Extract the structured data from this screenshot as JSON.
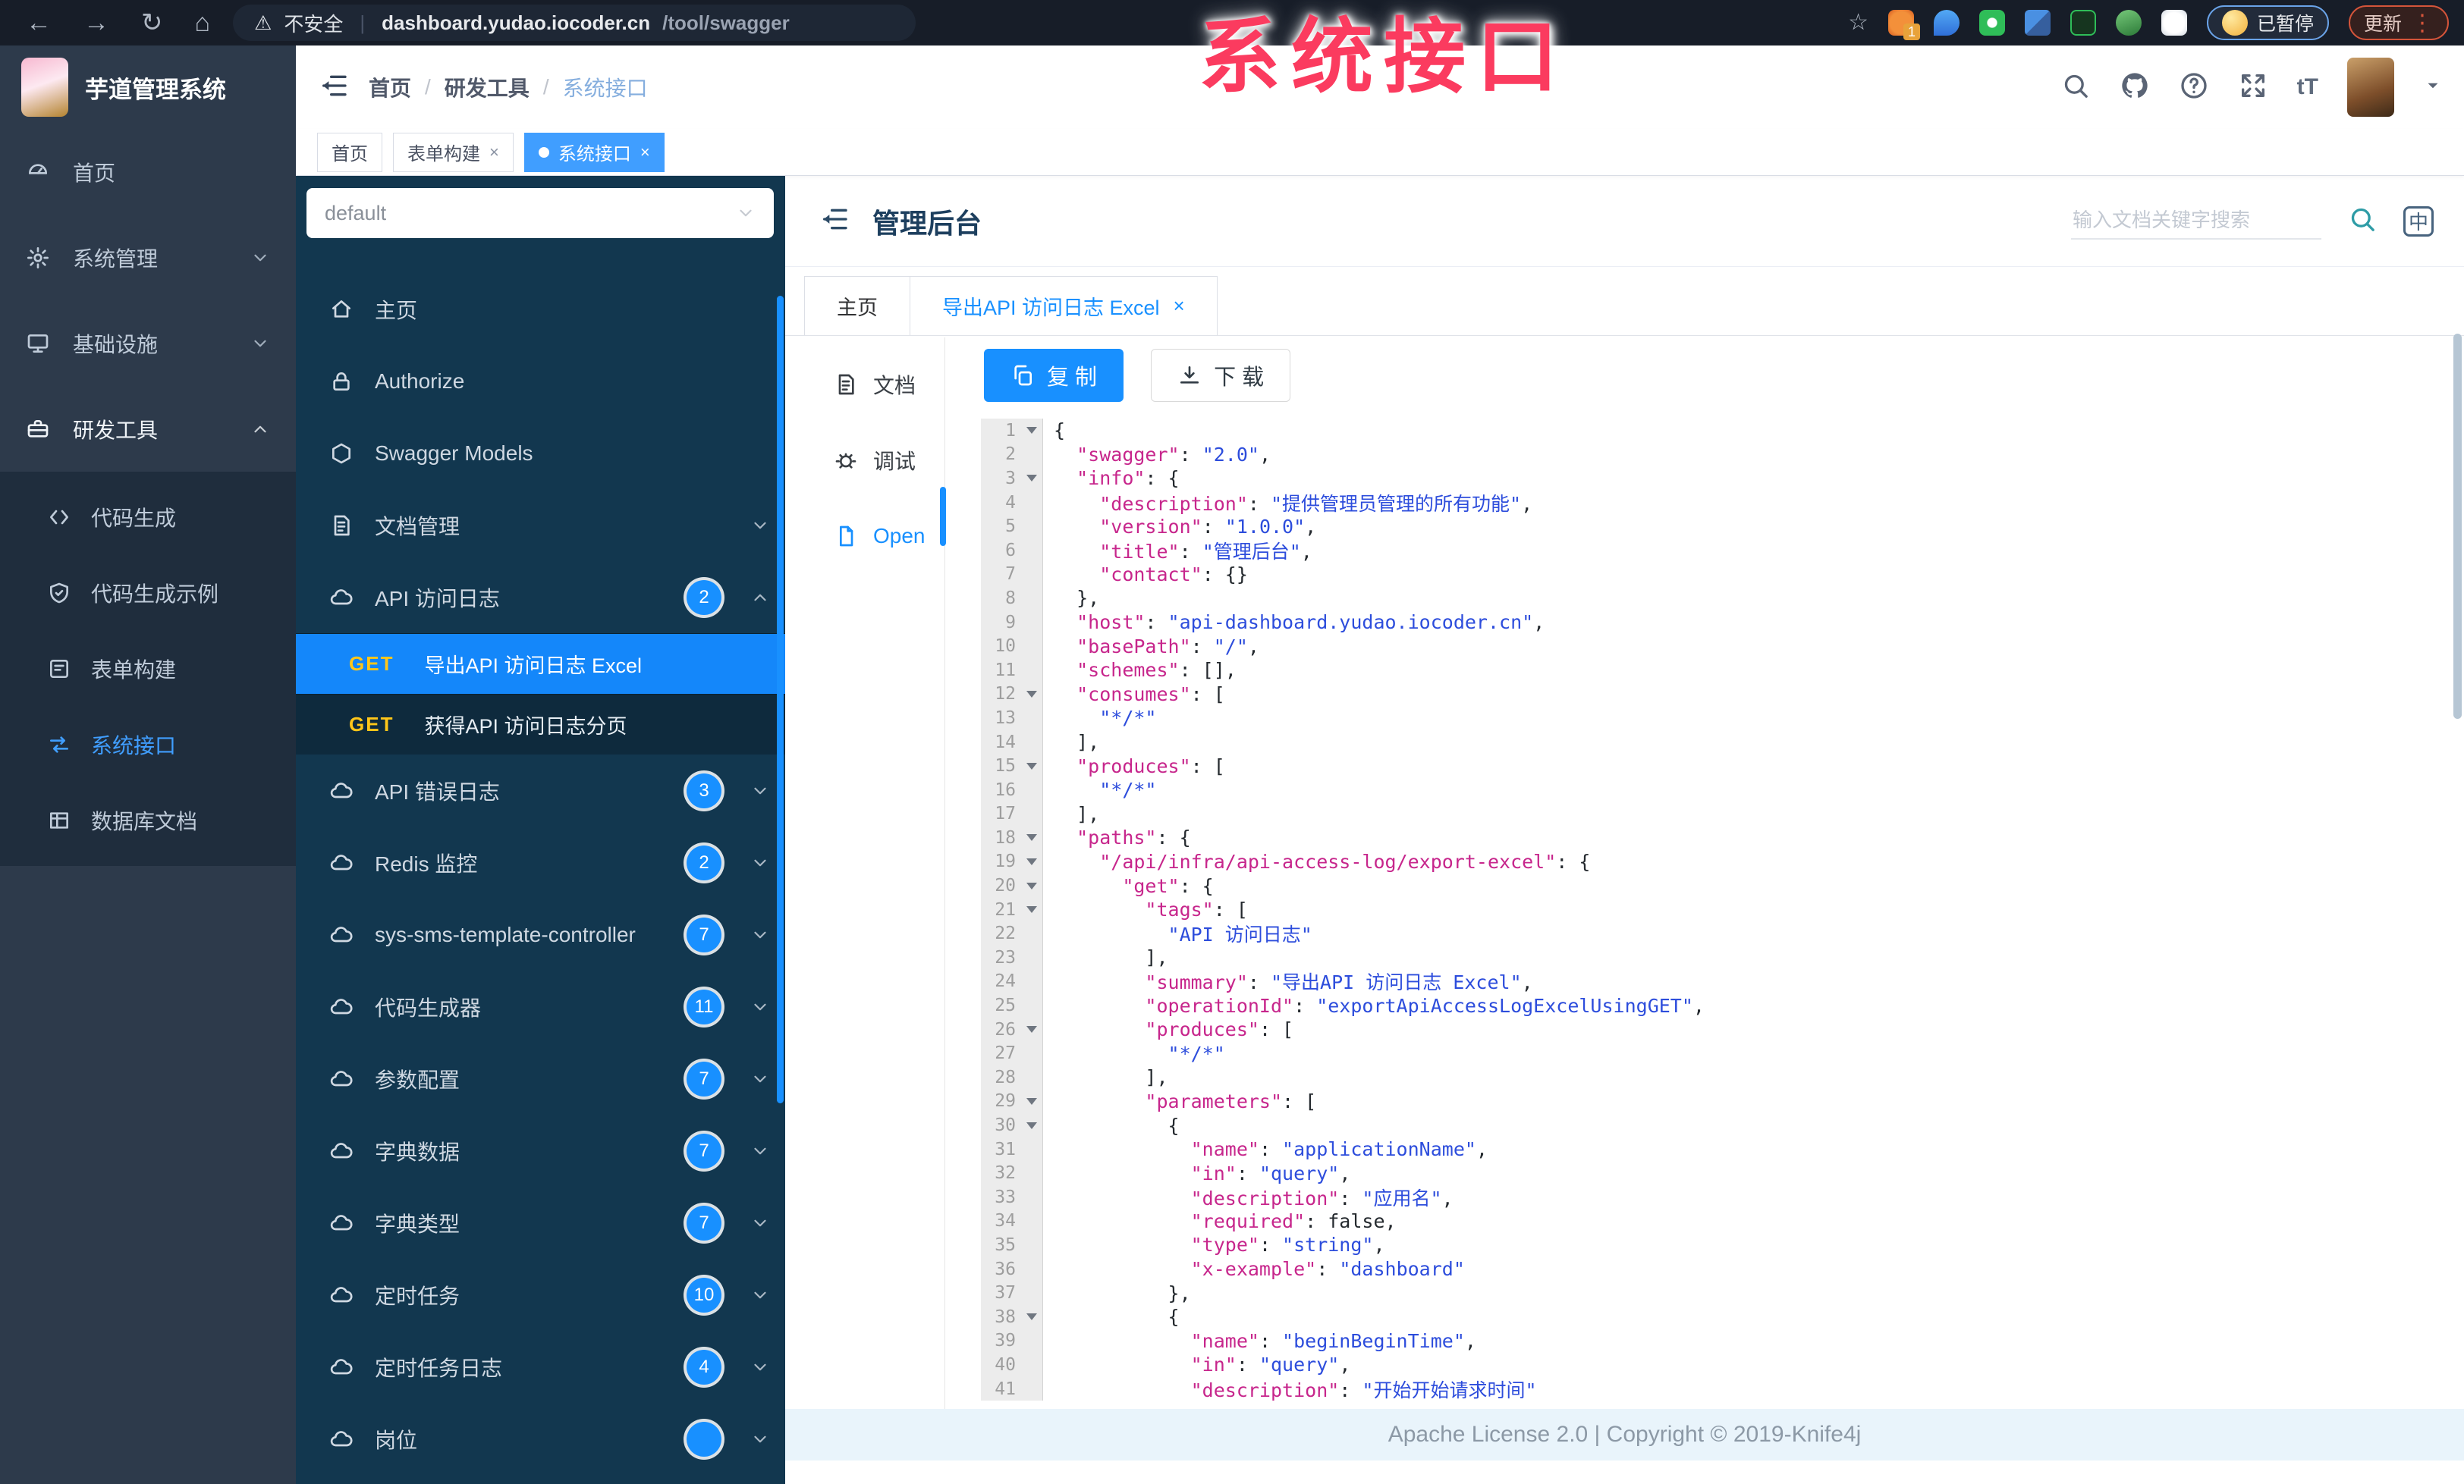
{
  "browser": {
    "security_label": "不安全",
    "url_host": "dashboard.yudao.iocoder.cn",
    "url_path": "/tool/swagger",
    "extension_badge": "1",
    "paused_label": "已暂停",
    "update_label": "更新"
  },
  "watermark": "系统接口",
  "colors": {
    "accent": "#1890ff",
    "sidebar_dark": "#2d3a4b",
    "knife4j_dark": "#12374f",
    "active_link": "#409eff",
    "method_get": "#ffc619",
    "code_key": "#c7268c",
    "code_string": "#2d4ddc"
  },
  "app_header": {
    "logo_title": "芋道管理系统",
    "breadcrumb": [
      "首页",
      "研发工具",
      "系统接口"
    ]
  },
  "tags": [
    {
      "label": "首页",
      "closable": false,
      "active": false
    },
    {
      "label": "表单构建",
      "closable": true,
      "active": false
    },
    {
      "label": "系统接口",
      "closable": true,
      "active": true
    }
  ],
  "sidebar": {
    "items": [
      {
        "icon": "dash",
        "label": "首页",
        "chevron": null,
        "open": false
      },
      {
        "icon": "gear",
        "label": "系统管理",
        "chevron": "down",
        "open": false
      },
      {
        "icon": "monitor",
        "label": "基础设施",
        "chevron": "down",
        "open": false
      },
      {
        "icon": "toolbox",
        "label": "研发工具",
        "chevron": "up",
        "open": true
      }
    ],
    "sub_items": [
      {
        "icon": "code",
        "label": "代码生成",
        "active": false
      },
      {
        "icon": "shield",
        "label": "代码生成示例",
        "active": false
      },
      {
        "icon": "form",
        "label": "表单构建",
        "active": false
      },
      {
        "icon": "swagger",
        "label": "系统接口",
        "active": true
      },
      {
        "icon": "table",
        "label": "数据库文档",
        "active": false
      }
    ]
  },
  "api_sidebar": {
    "group_select_value": "default",
    "items": [
      {
        "type": "link",
        "icon": "khome",
        "label": "主页"
      },
      {
        "type": "link",
        "icon": "lock",
        "label": "Authorize"
      },
      {
        "type": "link",
        "icon": "hexagon",
        "label": "Swagger Models"
      },
      {
        "type": "group",
        "icon": "docfile",
        "label": "文档管理",
        "badge": null,
        "chevron": "down"
      },
      {
        "type": "group",
        "icon": "cloud",
        "label": "API 访问日志",
        "badge": "2",
        "chevron": "up"
      },
      {
        "type": "endpoint",
        "method": "GET",
        "label": "导出API 访问日志 Excel",
        "active": true
      },
      {
        "type": "endpoint",
        "method": "GET",
        "label": "获得API 访问日志分页",
        "active": false
      },
      {
        "type": "group",
        "icon": "cloud",
        "label": "API 错误日志",
        "badge": "3",
        "chevron": "down"
      },
      {
        "type": "group",
        "icon": "cloud",
        "label": "Redis 监控",
        "badge": "2",
        "chevron": "down"
      },
      {
        "type": "group",
        "icon": "cloud",
        "label": "sys-sms-template-controller",
        "badge": "7",
        "chevron": "down"
      },
      {
        "type": "group",
        "icon": "cloud",
        "label": "代码生成器",
        "badge": "11",
        "chevron": "down"
      },
      {
        "type": "group",
        "icon": "cloud",
        "label": "参数配置",
        "badge": "7",
        "chevron": "down"
      },
      {
        "type": "group",
        "icon": "cloud",
        "label": "字典数据",
        "badge": "7",
        "chevron": "down"
      },
      {
        "type": "group",
        "icon": "cloud",
        "label": "字典类型",
        "badge": "7",
        "chevron": "down"
      },
      {
        "type": "group",
        "icon": "cloud",
        "label": "定时任务",
        "badge": "10",
        "chevron": "down"
      },
      {
        "type": "group",
        "icon": "cloud",
        "label": "定时任务日志",
        "badge": "4",
        "chevron": "down"
      },
      {
        "type": "group",
        "icon": "cloud",
        "label": "岗位",
        "badge": "",
        "chevron": "down"
      }
    ]
  },
  "main": {
    "title": "管理后台",
    "search_placeholder": "输入文档关键字搜索",
    "lang_icon_label": "中",
    "doc_tabs": [
      {
        "label": "主页",
        "closable": false,
        "active": false
      },
      {
        "label": "导出API 访问日志 Excel",
        "closable": true,
        "active": true
      }
    ],
    "doc_nav": [
      {
        "icon": "docfile",
        "label": "文档",
        "active": false
      },
      {
        "icon": "bug",
        "label": "调试",
        "active": false
      },
      {
        "icon": "file",
        "label": "Open",
        "active": true
      }
    ],
    "copy_label": "复 制",
    "download_label": "下 载",
    "footer": "Apache License 2.0 | Copyright © 2019-Knife4j"
  },
  "code": {
    "lines": [
      {
        "n": 1,
        "fold": true,
        "ind": 0,
        "toks": [
          [
            "p",
            "{"
          ]
        ]
      },
      {
        "n": 2,
        "fold": false,
        "ind": 2,
        "toks": [
          [
            "k",
            "\"swagger\""
          ],
          [
            "p",
            ": "
          ],
          [
            "s",
            "\"2.0\""
          ],
          [
            "p",
            ","
          ]
        ]
      },
      {
        "n": 3,
        "fold": true,
        "ind": 2,
        "toks": [
          [
            "k",
            "\"info\""
          ],
          [
            "p",
            ": {"
          ]
        ]
      },
      {
        "n": 4,
        "fold": false,
        "ind": 4,
        "toks": [
          [
            "k",
            "\"description\""
          ],
          [
            "p",
            ": "
          ],
          [
            "s",
            "\"提供管理员管理的所有功能\""
          ],
          [
            "p",
            ","
          ]
        ]
      },
      {
        "n": 5,
        "fold": false,
        "ind": 4,
        "toks": [
          [
            "k",
            "\"version\""
          ],
          [
            "p",
            ": "
          ],
          [
            "s",
            "\"1.0.0\""
          ],
          [
            "p",
            ","
          ]
        ]
      },
      {
        "n": 6,
        "fold": false,
        "ind": 4,
        "toks": [
          [
            "k",
            "\"title\""
          ],
          [
            "p",
            ": "
          ],
          [
            "s",
            "\"管理后台\""
          ],
          [
            "p",
            ","
          ]
        ]
      },
      {
        "n": 7,
        "fold": false,
        "ind": 4,
        "toks": [
          [
            "k",
            "\"contact\""
          ],
          [
            "p",
            ": {}"
          ]
        ]
      },
      {
        "n": 8,
        "fold": false,
        "ind": 2,
        "toks": [
          [
            "p",
            "},"
          ]
        ]
      },
      {
        "n": 9,
        "fold": false,
        "ind": 2,
        "toks": [
          [
            "k",
            "\"host\""
          ],
          [
            "p",
            ": "
          ],
          [
            "s",
            "\"api-dashboard.yudao.iocoder.cn\""
          ],
          [
            "p",
            ","
          ]
        ]
      },
      {
        "n": 10,
        "fold": false,
        "ind": 2,
        "toks": [
          [
            "k",
            "\"basePath\""
          ],
          [
            "p",
            ": "
          ],
          [
            "s",
            "\"/\""
          ],
          [
            "p",
            ","
          ]
        ]
      },
      {
        "n": 11,
        "fold": false,
        "ind": 2,
        "toks": [
          [
            "k",
            "\"schemes\""
          ],
          [
            "p",
            ": [],"
          ]
        ]
      },
      {
        "n": 12,
        "fold": true,
        "ind": 2,
        "toks": [
          [
            "k",
            "\"consumes\""
          ],
          [
            "p",
            ": ["
          ]
        ]
      },
      {
        "n": 13,
        "fold": false,
        "ind": 4,
        "toks": [
          [
            "s",
            "\"*/*\""
          ]
        ]
      },
      {
        "n": 14,
        "fold": false,
        "ind": 2,
        "toks": [
          [
            "p",
            "],"
          ]
        ]
      },
      {
        "n": 15,
        "fold": true,
        "ind": 2,
        "toks": [
          [
            "k",
            "\"produces\""
          ],
          [
            "p",
            ": ["
          ]
        ]
      },
      {
        "n": 16,
        "fold": false,
        "ind": 4,
        "toks": [
          [
            "s",
            "\"*/*\""
          ]
        ]
      },
      {
        "n": 17,
        "fold": false,
        "ind": 2,
        "toks": [
          [
            "p",
            "],"
          ]
        ]
      },
      {
        "n": 18,
        "fold": true,
        "ind": 2,
        "toks": [
          [
            "k",
            "\"paths\""
          ],
          [
            "p",
            ": {"
          ]
        ]
      },
      {
        "n": 19,
        "fold": true,
        "ind": 4,
        "toks": [
          [
            "k",
            "\"/api/infra/api-access-log/export-excel\""
          ],
          [
            "p",
            ": {"
          ]
        ]
      },
      {
        "n": 20,
        "fold": true,
        "ind": 6,
        "toks": [
          [
            "k",
            "\"get\""
          ],
          [
            "p",
            ": {"
          ]
        ]
      },
      {
        "n": 21,
        "fold": true,
        "ind": 8,
        "toks": [
          [
            "k",
            "\"tags\""
          ],
          [
            "p",
            ": ["
          ]
        ]
      },
      {
        "n": 22,
        "fold": false,
        "ind": 10,
        "toks": [
          [
            "s",
            "\"API 访问日志\""
          ]
        ]
      },
      {
        "n": 23,
        "fold": false,
        "ind": 8,
        "toks": [
          [
            "p",
            "],"
          ]
        ]
      },
      {
        "n": 24,
        "fold": false,
        "ind": 8,
        "toks": [
          [
            "k",
            "\"summary\""
          ],
          [
            "p",
            ": "
          ],
          [
            "s",
            "\"导出API 访问日志 Excel\""
          ],
          [
            "p",
            ","
          ]
        ]
      },
      {
        "n": 25,
        "fold": false,
        "ind": 8,
        "toks": [
          [
            "k",
            "\"operationId\""
          ],
          [
            "p",
            ": "
          ],
          [
            "s",
            "\"exportApiAccessLogExcelUsingGET\""
          ],
          [
            "p",
            ","
          ]
        ]
      },
      {
        "n": 26,
        "fold": true,
        "ind": 8,
        "toks": [
          [
            "k",
            "\"produces\""
          ],
          [
            "p",
            ": ["
          ]
        ]
      },
      {
        "n": 27,
        "fold": false,
        "ind": 10,
        "toks": [
          [
            "s",
            "\"*/*\""
          ]
        ]
      },
      {
        "n": 28,
        "fold": false,
        "ind": 8,
        "toks": [
          [
            "p",
            "],"
          ]
        ]
      },
      {
        "n": 29,
        "fold": true,
        "ind": 8,
        "toks": [
          [
            "k",
            "\"parameters\""
          ],
          [
            "p",
            ": ["
          ]
        ]
      },
      {
        "n": 30,
        "fold": true,
        "ind": 10,
        "toks": [
          [
            "p",
            "{"
          ]
        ]
      },
      {
        "n": 31,
        "fold": false,
        "ind": 12,
        "toks": [
          [
            "k",
            "\"name\""
          ],
          [
            "p",
            ": "
          ],
          [
            "s",
            "\"applicationName\""
          ],
          [
            "p",
            ","
          ]
        ]
      },
      {
        "n": 32,
        "fold": false,
        "ind": 12,
        "toks": [
          [
            "k",
            "\"in\""
          ],
          [
            "p",
            ": "
          ],
          [
            "s",
            "\"query\""
          ],
          [
            "p",
            ","
          ]
        ]
      },
      {
        "n": 33,
        "fold": false,
        "ind": 12,
        "toks": [
          [
            "k",
            "\"description\""
          ],
          [
            "p",
            ": "
          ],
          [
            "s",
            "\"应用名\""
          ],
          [
            "p",
            ","
          ]
        ]
      },
      {
        "n": 34,
        "fold": false,
        "ind": 12,
        "toks": [
          [
            "k",
            "\"required\""
          ],
          [
            "p",
            ": "
          ],
          [
            "b",
            "false"
          ],
          [
            "p",
            ","
          ]
        ]
      },
      {
        "n": 35,
        "fold": false,
        "ind": 12,
        "toks": [
          [
            "k",
            "\"type\""
          ],
          [
            "p",
            ": "
          ],
          [
            "s",
            "\"string\""
          ],
          [
            "p",
            ","
          ]
        ]
      },
      {
        "n": 36,
        "fold": false,
        "ind": 12,
        "toks": [
          [
            "k",
            "\"x-example\""
          ],
          [
            "p",
            ": "
          ],
          [
            "s",
            "\"dashboard\""
          ]
        ]
      },
      {
        "n": 37,
        "fold": false,
        "ind": 10,
        "toks": [
          [
            "p",
            "},"
          ]
        ]
      },
      {
        "n": 38,
        "fold": true,
        "ind": 10,
        "toks": [
          [
            "p",
            "{"
          ]
        ]
      },
      {
        "n": 39,
        "fold": false,
        "ind": 12,
        "toks": [
          [
            "k",
            "\"name\""
          ],
          [
            "p",
            ": "
          ],
          [
            "s",
            "\"beginBeginTime\""
          ],
          [
            "p",
            ","
          ]
        ]
      },
      {
        "n": 40,
        "fold": false,
        "ind": 12,
        "toks": [
          [
            "k",
            "\"in\""
          ],
          [
            "p",
            ": "
          ],
          [
            "s",
            "\"query\""
          ],
          [
            "p",
            ","
          ]
        ]
      },
      {
        "n": 41,
        "fold": false,
        "ind": 12,
        "toks": [
          [
            "k",
            "\"description\""
          ],
          [
            "p",
            ": "
          ],
          [
            "s",
            "\"开始开始请求时间\""
          ]
        ]
      }
    ]
  }
}
